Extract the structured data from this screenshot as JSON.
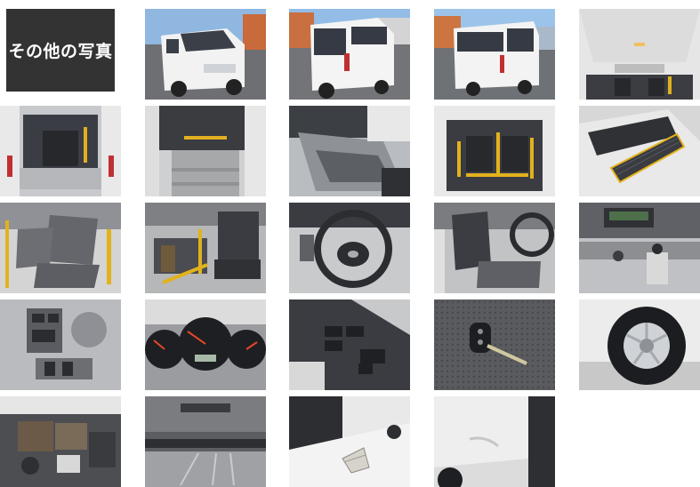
{
  "gallery": {
    "label": "その他の写真",
    "photos": [
      {
        "name": "photo-exterior-front"
      },
      {
        "name": "photo-exterior-rear-left"
      },
      {
        "name": "photo-exterior-rear-right"
      },
      {
        "name": "photo-interior-ceiling"
      },
      {
        "name": "photo-rear-lift-open"
      },
      {
        "name": "photo-lift-platform"
      },
      {
        "name": "photo-lift-side-view"
      },
      {
        "name": "photo-rear-seats-yellow-rails"
      },
      {
        "name": "photo-lift-ramp-detail"
      },
      {
        "name": "photo-rear-seats-closeup"
      },
      {
        "name": "photo-wheelchair-area"
      },
      {
        "name": "photo-steering-wheel"
      },
      {
        "name": "photo-driver-seat"
      },
      {
        "name": "photo-center-console"
      },
      {
        "name": "photo-dash-switches"
      },
      {
        "name": "photo-gauge-cluster"
      },
      {
        "name": "photo-door-window-switches"
      },
      {
        "name": "photo-key"
      },
      {
        "name": "photo-tire"
      },
      {
        "name": "photo-engine-bay"
      },
      {
        "name": "photo-underbody"
      },
      {
        "name": "photo-bumper-scratch"
      },
      {
        "name": "photo-body-dent"
      }
    ]
  }
}
